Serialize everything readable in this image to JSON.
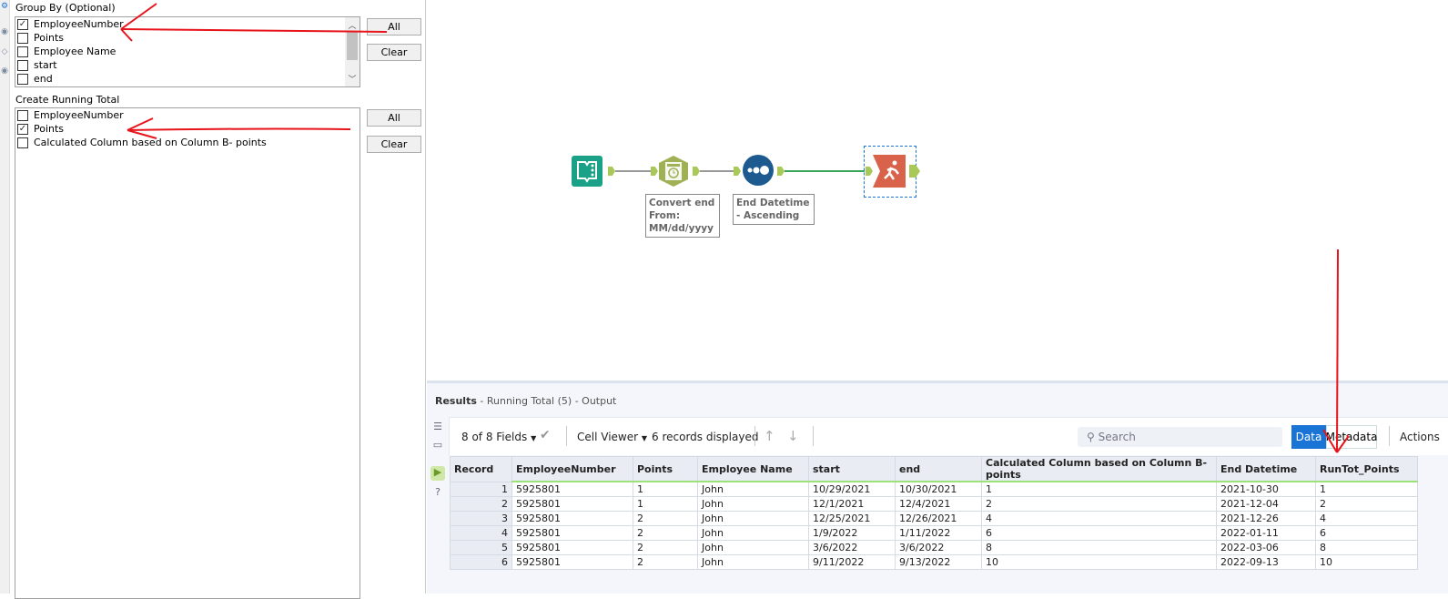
{
  "group_by": {
    "label": "Group By (Optional)",
    "items": [
      {
        "label": "EmployeeNumber",
        "checked": true
      },
      {
        "label": "Points",
        "checked": false
      },
      {
        "label": "Employee Name",
        "checked": false
      },
      {
        "label": "start",
        "checked": false
      },
      {
        "label": "end",
        "checked": false
      }
    ],
    "all_label": "All",
    "clear_label": "Clear"
  },
  "running_total": {
    "label": "Create Running Total",
    "items": [
      {
        "label": "EmployeeNumber",
        "checked": false
      },
      {
        "label": "Points",
        "checked": true
      },
      {
        "label": "Calculated Column based on Column B- points",
        "checked": false
      }
    ],
    "all_label": "All",
    "clear_label": "Clear"
  },
  "workflow": {
    "annotations": [
      "Convert end From: MM/dd/yyyy",
      "End Datetime - Ascending"
    ],
    "colors": {
      "input": "#1aa188",
      "datetime": "#a0b055",
      "sort": "#1c5a8f",
      "running_total": "#d9624a",
      "connection_active": "#3aa55a"
    }
  },
  "results": {
    "title": "Results",
    "subtitle": " - Running Total (5) - Output",
    "fields": "8 of 8 Fields",
    "cell_viewer": "Cell Viewer",
    "records": "6 records displayed",
    "search_placeholder": "Search",
    "data_tab": "Data",
    "metadata_tab": "Metadata",
    "actions": "Actions",
    "columns": [
      "Record",
      "EmployeeNumber",
      "Points",
      "Employee Name",
      "start",
      "end",
      "Calculated Column based on Column B- points",
      "End Datetime",
      "RunTot_Points"
    ],
    "rows": [
      [
        "1",
        "5925801",
        "1",
        "John",
        "10/29/2021",
        "10/30/2021",
        "1",
        "2021-10-30",
        "1"
      ],
      [
        "2",
        "5925801",
        "1",
        "John",
        "12/1/2021",
        "12/4/2021",
        "2",
        "2021-12-04",
        "2"
      ],
      [
        "3",
        "5925801",
        "2",
        "John",
        "12/25/2021",
        "12/26/2021",
        "4",
        "2021-12-26",
        "4"
      ],
      [
        "4",
        "5925801",
        "2",
        "John",
        "1/9/2022",
        "1/11/2022",
        "6",
        "2022-01-11",
        "6"
      ],
      [
        "5",
        "5925801",
        "2",
        "John",
        "3/6/2022",
        "3/6/2022",
        "8",
        "2022-03-06",
        "8"
      ],
      [
        "6",
        "5925801",
        "2",
        "John",
        "9/11/2022",
        "9/13/2022",
        "10",
        "2022-09-13",
        "10"
      ]
    ]
  }
}
